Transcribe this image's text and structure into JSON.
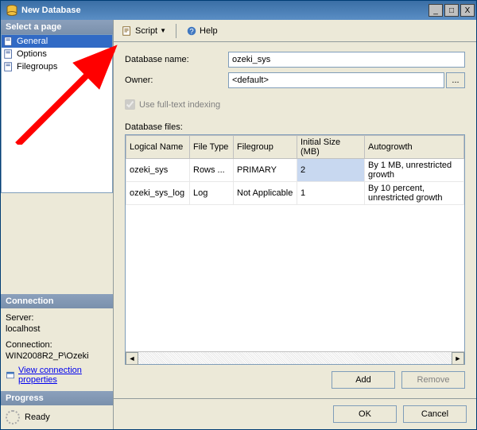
{
  "window": {
    "title": "New Database"
  },
  "titlebar_buttons": {
    "min": "_",
    "max": "□",
    "close": "X"
  },
  "left": {
    "select_page": "Select a page",
    "pages": [
      "General",
      "Options",
      "Filegroups"
    ],
    "connection_header": "Connection",
    "server_label": "Server:",
    "server_value": "localhost",
    "connection_label": "Connection:",
    "connection_value": "WIN2008R2_P\\Ozeki",
    "view_conn_props": "View connection properties",
    "progress_header": "Progress",
    "progress_status": "Ready"
  },
  "toolbar": {
    "script": "Script",
    "help": "Help"
  },
  "form": {
    "dbname_label": "Database name:",
    "dbname_value": "ozeki_sys",
    "owner_label": "Owner:",
    "owner_value": "<default>",
    "browse": "...",
    "fulltext": "Use full-text indexing",
    "files_label": "Database files:"
  },
  "grid": {
    "headers": [
      "Logical Name",
      "File Type",
      "Filegroup",
      "Initial Size (MB)",
      "Autogrowth"
    ],
    "rows": [
      {
        "name": "ozeki_sys",
        "type": "Rows ...",
        "fg": "PRIMARY",
        "size": "2",
        "auto": "By 1 MB, unrestricted growth"
      },
      {
        "name": "ozeki_sys_log",
        "type": "Log",
        "fg": "Not Applicable",
        "size": "1",
        "auto": "By 10 percent, unrestricted growth"
      }
    ]
  },
  "buttons": {
    "add": "Add",
    "remove": "Remove",
    "ok": "OK",
    "cancel": "Cancel"
  },
  "scrollbar": {
    "left": "◄",
    "right": "►"
  }
}
